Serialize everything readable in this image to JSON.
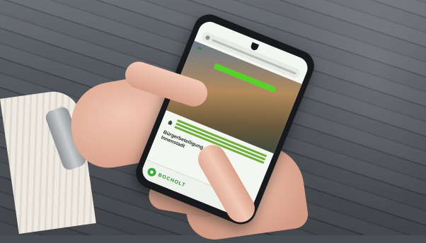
{
  "colors": {
    "accent_green": "#58d22b",
    "brand_green": "#3fa83a",
    "phone_body": "#17191c",
    "skin": "#e8b8a3"
  },
  "phone": {
    "hero_tag": "",
    "callout_text": "",
    "subtitle_line1": "Bürgerbeteiligung",
    "subtitle_line2": "Innenstadt",
    "logo_text": "BOCHOLT",
    "icons": [
      "home-icon",
      "search-icon",
      "menu-icon",
      "brand-logo-icon"
    ]
  }
}
